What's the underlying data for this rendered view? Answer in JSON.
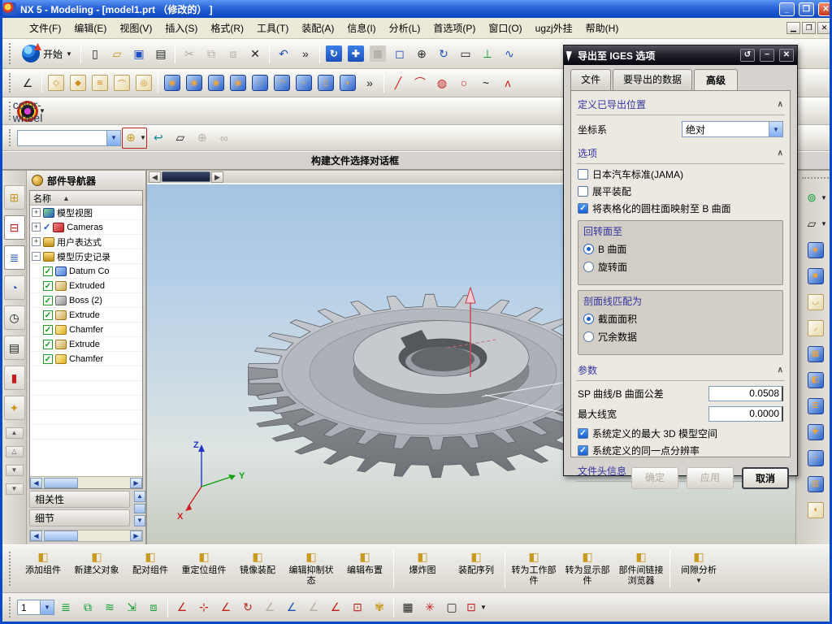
{
  "window": {
    "title": "NX 5 - Modeling - [model1.prt （修改的） ]"
  },
  "menu": {
    "items": [
      "文件(F)",
      "编辑(E)",
      "视图(V)",
      "插入(S)",
      "格式(R)",
      "工具(T)",
      "装配(A)",
      "信息(I)",
      "分析(L)",
      "首选项(P)",
      "窗口(O)",
      "ugzj外挂",
      "帮助(H)"
    ]
  },
  "toolbars": {
    "start_label": "开始",
    "selection_combo_value": "",
    "row1": [
      {
        "n": "new-file",
        "g": "▯",
        "c": "k"
      },
      {
        "n": "open",
        "g": "▱",
        "c": "y"
      },
      {
        "n": "save",
        "g": "▣",
        "c": "b"
      },
      {
        "n": "print",
        "g": "▤",
        "c": "k"
      },
      {
        "s": 1
      },
      {
        "n": "cut",
        "g": "✂",
        "c": "dis"
      },
      {
        "n": "copy",
        "g": "⧉",
        "c": "dis"
      },
      {
        "n": "paste",
        "g": "⧈",
        "c": "dis"
      },
      {
        "n": "delete",
        "g": "✕",
        "c": "k"
      },
      {
        "s": 1
      },
      {
        "n": "undo",
        "g": "↶",
        "c": "b"
      },
      {
        "n": "more-standard",
        "g": "»",
        "c": "k"
      },
      {
        "s": 1
      },
      {
        "n": "refresh",
        "g": "↻",
        "c": "bluebox"
      },
      {
        "n": "fit-view",
        "g": "✚",
        "c": "bluebox"
      },
      {
        "n": "fit-selection",
        "g": "▩",
        "c": "graybox"
      },
      {
        "n": "zoom-box",
        "g": "◻",
        "c": "b"
      },
      {
        "n": "zoom-in-out",
        "g": "⊕",
        "c": "k"
      },
      {
        "n": "rotate-view",
        "g": "↻",
        "c": "b"
      },
      {
        "n": "pan-view",
        "g": "▭",
        "c": "k"
      },
      {
        "n": "orient-view",
        "g": "⊥",
        "c": "grn"
      },
      {
        "n": "curve-freehand",
        "g": "∿",
        "c": "b"
      }
    ],
    "row2": [
      {
        "n": "sketcher",
        "g": "∠",
        "c": "k"
      },
      {
        "s": 1
      },
      {
        "n": "datum-csys",
        "g": "◇",
        "c": "ghost"
      },
      {
        "n": "hole-ghost",
        "g": "◆",
        "c": "ghost"
      },
      {
        "n": "sweep-ghost",
        "g": "≋",
        "c": "ghost"
      },
      {
        "n": "pipe-ghost",
        "g": "⌒",
        "c": "ghost"
      },
      {
        "n": "cylinder-ghost",
        "g": "◎",
        "c": "ghost"
      },
      {
        "s": 1
      },
      {
        "n": "extrude",
        "g": "◉",
        "c": "cube"
      },
      {
        "n": "revolve",
        "g": "◉",
        "c": "cube"
      },
      {
        "n": "hole",
        "g": "◉",
        "c": "cube"
      },
      {
        "n": "boss",
        "g": "◉",
        "c": "cube"
      },
      {
        "n": "pocket",
        "g": "◌",
        "c": "cube"
      },
      {
        "n": "pad",
        "g": "◠",
        "c": "cube"
      },
      {
        "n": "rib",
        "g": "▫",
        "c": "cube"
      },
      {
        "n": "emboss",
        "g": "▯",
        "c": "cube"
      },
      {
        "n": "trim",
        "g": "◗",
        "c": "cube"
      },
      {
        "n": "more-feature",
        "g": "»",
        "c": "k"
      },
      {
        "s": 1
      },
      {
        "n": "line",
        "g": "╱",
        "c": "red"
      },
      {
        "n": "arc",
        "g": "⌒",
        "c": "red"
      },
      {
        "n": "circle-point",
        "g": "◍",
        "c": "red"
      },
      {
        "n": "circle",
        "g": "○",
        "c": "red"
      },
      {
        "n": "conic",
        "g": "~",
        "c": "k"
      },
      {
        "n": "polyline",
        "g": "ʌ",
        "c": "red"
      }
    ],
    "row3": [
      {
        "n": "color-wheel",
        "g": "",
        "c": "wheel",
        "a": 1
      }
    ],
    "row4": [
      {
        "n": "selection-filter",
        "g": "⊕",
        "c": "y",
        "a": 1,
        "boxed": 1
      },
      {
        "n": "back-arrow",
        "g": "↩",
        "c": "t"
      },
      {
        "n": "eraser",
        "g": "▱",
        "c": "k"
      },
      {
        "n": "snap-point",
        "g": "⊕",
        "c": "dis"
      },
      {
        "n": "chain-curve",
        "g": "∞",
        "c": "dis"
      }
    ],
    "resbar": [
      {
        "n": "assembly-navigator",
        "g": "⊞",
        "cl": "y"
      },
      {
        "n": "constraint-navigator",
        "g": "⊟",
        "cl": "r",
        "active": 1
      },
      {
        "n": "part-navigator",
        "g": "≣",
        "cl": "b",
        "active": 1
      },
      {
        "n": "reuse-library",
        "g": "◔",
        "cl": "b"
      },
      {
        "n": "history",
        "g": "◷",
        "cl": "k"
      },
      {
        "n": "system-materials",
        "g": "▤",
        "cl": "k"
      },
      {
        "n": "visualization",
        "g": "▮",
        "cl": "r"
      },
      {
        "n": "roles",
        "g": "✦",
        "cl": "y"
      }
    ],
    "rtools": [
      {
        "n": "sketch",
        "g": "⊚",
        "c": "grn",
        "a": 1
      },
      {
        "n": "datum-plane",
        "g": "▱",
        "c": "k",
        "a": 1
      },
      {
        "n": "extrude-body",
        "g": "◈",
        "c": "cube"
      },
      {
        "n": "block",
        "g": "■",
        "c": "cube"
      },
      {
        "n": "bend",
        "g": "◡",
        "c": "ghost"
      },
      {
        "n": "flange",
        "g": "◞",
        "c": "ghost"
      },
      {
        "n": "box-top",
        "g": "▦",
        "c": "cube"
      },
      {
        "n": "shell",
        "g": "◧",
        "c": "cube"
      },
      {
        "n": "thread",
        "g": "≣",
        "c": "cube"
      },
      {
        "n": "unite",
        "g": "✚",
        "c": "cube"
      },
      {
        "n": "subtract",
        "g": "−",
        "c": "cube"
      },
      {
        "n": "sew",
        "g": "▥",
        "c": "cube"
      },
      {
        "n": "trim-body",
        "g": "◖",
        "c": "ghost"
      }
    ],
    "botbar": [
      {
        "n": "layer-settings",
        "g": "≣",
        "c": "grn"
      },
      {
        "n": "layer-visible-in-view",
        "g": "⧉",
        "c": "grn"
      },
      {
        "n": "layer-category",
        "g": "≋",
        "c": "grn"
      },
      {
        "n": "move-to-layer",
        "g": "⇲",
        "c": "grn"
      },
      {
        "n": "copy-to-layer",
        "g": "⧈",
        "c": "grn"
      },
      {
        "s": 1
      },
      {
        "n": "wcs-dynamics",
        "g": "∠",
        "c": "red"
      },
      {
        "n": "wcs-constraint",
        "g": "⊹",
        "c": "red"
      },
      {
        "n": "wcs-origin",
        "g": "∠",
        "c": "red"
      },
      {
        "n": "wcs-rotate",
        "g": "↻",
        "c": "red"
      },
      {
        "n": "wcs-orient",
        "g": "∠",
        "c": "dis"
      },
      {
        "n": "wcs-set-absolute",
        "g": "∠",
        "c": "b"
      },
      {
        "n": "wcs-xc",
        "g": "∠",
        "c": "dis"
      },
      {
        "n": "wcs-yc",
        "g": "∠",
        "c": "red"
      },
      {
        "n": "wcs-save",
        "g": "⊡",
        "c": "red"
      },
      {
        "n": "wcs-display",
        "g": "✾",
        "c": "y"
      },
      {
        "s": 1
      },
      {
        "n": "grid",
        "g": "▦",
        "c": "k"
      },
      {
        "n": "snap-pattern",
        "g": "✳",
        "c": "red"
      },
      {
        "n": "view-plane",
        "g": "▢",
        "c": "k"
      },
      {
        "n": "view-section",
        "g": "⊡",
        "c": "red",
        "a": 1
      }
    ],
    "layer_combo_value": "1"
  },
  "prompt_bar": {
    "text": "构建文件选择对话框"
  },
  "navigator": {
    "title": "部件导航器",
    "name_col": "名称",
    "sort_icon": "▲",
    "tree": [
      {
        "t": "模型视图",
        "exp": "+",
        "icon": "mview"
      },
      {
        "t": "Cameras",
        "exp": "+",
        "icon": "cam",
        "tick": "✓"
      },
      {
        "t": "用户表达式",
        "exp": "+",
        "icon": "folder"
      },
      {
        "t": "模型历史记录",
        "exp": "−",
        "icon": "folder"
      },
      {
        "t": "Datum Co",
        "child": 1,
        "icon": "datum",
        "chk": "✓"
      },
      {
        "t": "Extruded",
        "child": 1,
        "icon": "extr",
        "chk": "✓"
      },
      {
        "t": "Boss (2)",
        "child": 1,
        "icon": "boss",
        "chk": "✓"
      },
      {
        "t": "Extrude",
        "child": 1,
        "icon": "extr",
        "chk": "✓"
      },
      {
        "t": "Chamfer",
        "child": 1,
        "icon": "chmf",
        "chk": "✓"
      },
      {
        "t": "Extrude",
        "child": 1,
        "icon": "extr",
        "chk": "✓"
      },
      {
        "t": "Chamfer",
        "child": 1,
        "icon": "chmf",
        "chk": "✓"
      }
    ],
    "footer_sections": [
      "相关性",
      "细节"
    ]
  },
  "dialog": {
    "title": "导出至 IGES 选项",
    "tabs": [
      "文件",
      "要导出的数据",
      "高级"
    ],
    "active_tab_index": 2,
    "export_location": {
      "title": "定义已导出位置",
      "csys_label": "坐标系",
      "csys_value": "绝对"
    },
    "options": {
      "title": "选项",
      "checkboxes": [
        {
          "label": "日本汽车标准(JAMA)",
          "checked": false
        },
        {
          "label": "展平装配",
          "checked": false
        },
        {
          "label": "将表格化的圆柱面映射至 B 曲面",
          "checked": true
        }
      ],
      "revolve_group": {
        "title": "回转面至",
        "options": [
          {
            "label": "B 曲面",
            "selected": true
          },
          {
            "label": "旋转面",
            "selected": false
          }
        ]
      },
      "hatch_group": {
        "title": "剖面线匹配为",
        "options": [
          {
            "label": "截面面积",
            "selected": true
          },
          {
            "label": "冗余数据",
            "selected": false
          }
        ]
      }
    },
    "parameters": {
      "title": "参数",
      "fields": [
        {
          "label": "SP 曲线/B 曲面公差",
          "value": "0.0508"
        },
        {
          "label": "最大线宽",
          "value": "0.0000"
        }
      ],
      "checkboxes": [
        {
          "label": "系统定义的最大 3D 模型空间",
          "checked": true
        },
        {
          "label": "系统定义的同一点分辨率",
          "checked": true
        }
      ]
    },
    "header_info": {
      "title": "文件头信息"
    },
    "buttons": {
      "ok": "确定",
      "apply": "应用",
      "cancel": "取消"
    }
  },
  "assembly_toolbar": {
    "items": [
      {
        "label": "添加组件",
        "icon": "add-component"
      },
      {
        "label": "新建父对象",
        "icon": "new-parent"
      },
      {
        "label": "配对组件",
        "icon": "mate-component"
      },
      {
        "label": "重定位组件",
        "icon": "reposition-component"
      },
      {
        "label": "镜像装配",
        "icon": "mirror-assembly"
      },
      {
        "label": "编辑抑制状态",
        "icon": "edit-suppression"
      },
      {
        "label": "编辑布置",
        "icon": "edit-arrangement"
      },
      {
        "sep": 1
      },
      {
        "label": "爆炸图",
        "icon": "exploded-view"
      },
      {
        "label": "装配序列",
        "icon": "assembly-sequence"
      },
      {
        "sep": 1
      },
      {
        "label": "转为工作部件",
        "icon": "make-work-part"
      },
      {
        "label": "转为显示部件",
        "icon": "make-displayed-part"
      },
      {
        "label": "部件间链接浏览器",
        "icon": "interpart-link-browser"
      },
      {
        "sep": 1
      },
      {
        "label": "间隙分析",
        "icon": "clearance-analysis",
        "arrow": 1
      }
    ]
  },
  "triad": {
    "x": "X",
    "y": "Y",
    "z": "Z"
  },
  "colors": {
    "titlebar": "#0a49c8",
    "dialog_title": "#0c0c14",
    "graphics_top": "#a2c2e2",
    "accent_blue": "#1c5fd0",
    "section_title": "#3333a0"
  }
}
